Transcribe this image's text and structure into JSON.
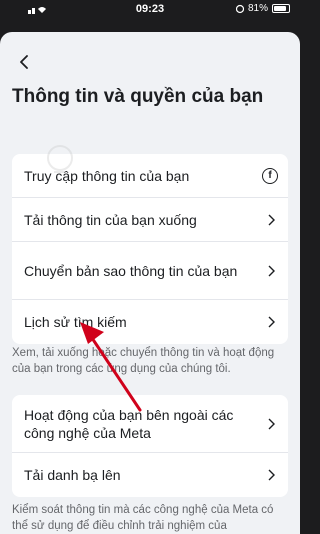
{
  "status_bar": {
    "time": "09:23",
    "battery": "81%"
  },
  "header": {
    "title": "Thông tin và quyền của bạn"
  },
  "section1": {
    "items": [
      {
        "label": "Truy cập thông tin của bạn"
      },
      {
        "label": "Tải thông tin của bạn xuống"
      },
      {
        "label": "Chuyển bản sao thông tin của bạn"
      },
      {
        "label": "Lịch sử tìm kiếm"
      }
    ],
    "description": "Xem, tải xuống hoặc chuyển thông tin và hoạt động của bạn trong các ứng dụng của chúng tôi."
  },
  "section2": {
    "items": [
      {
        "label": "Hoạt động của bạn bên ngoài các công nghệ của Meta"
      },
      {
        "label": "Tải danh bạ lên"
      }
    ],
    "description": "Kiểm soát thông tin mà các công nghệ của Meta có thể sử dụng để điều chỉnh trải nghiệm của"
  },
  "icons": {
    "back": "back-arrow-icon",
    "chevron": "chevron-right-icon",
    "facebook": "facebook-icon"
  },
  "colors": {
    "background": "#f0f2f5",
    "card": "#ffffff",
    "text": "#1c1e21",
    "secondary_text": "#65676b",
    "annotation": "#d0021b"
  }
}
